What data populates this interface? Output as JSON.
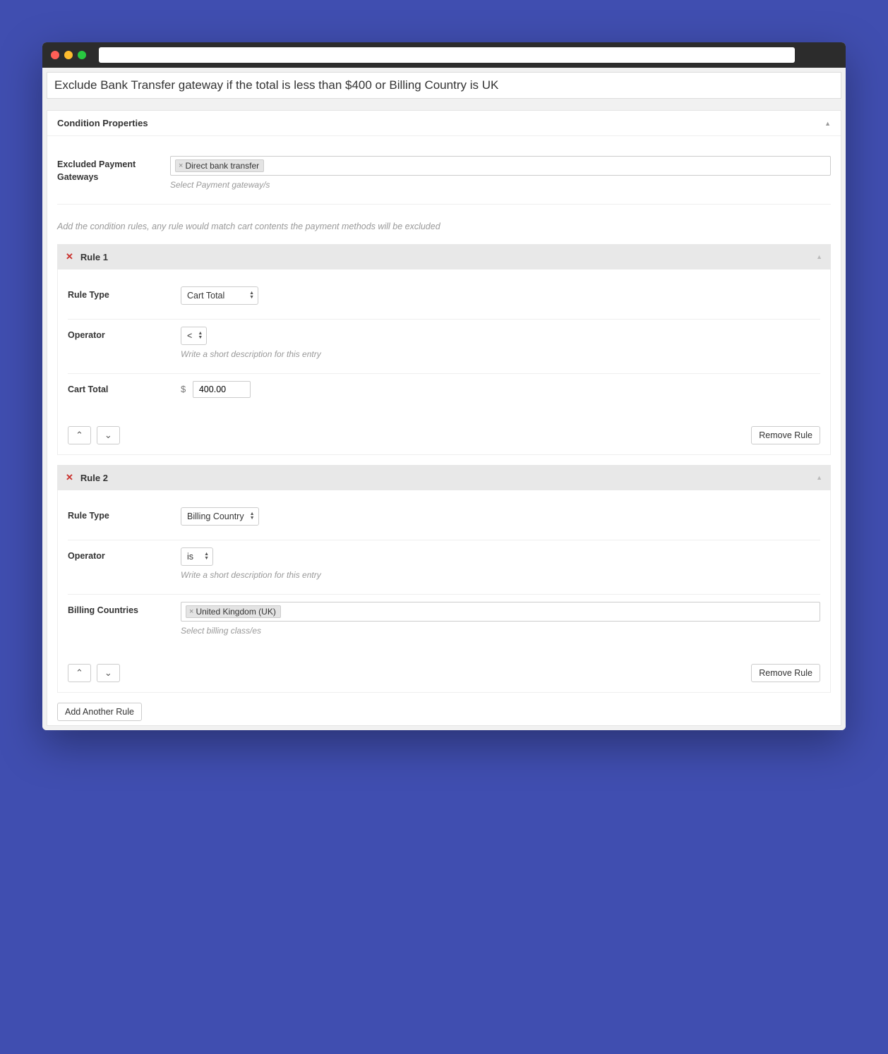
{
  "titleInput": "Exclude Bank Transfer gateway if the total is less than $400 or Billing Country is UK",
  "section": {
    "title": "Condition Properties"
  },
  "excludedGateways": {
    "label": "Excluded Payment Gateways",
    "tags": [
      "Direct bank transfer"
    ],
    "help": "Select Payment gateway/s"
  },
  "infoText": "Add the condition rules, any rule would match cart contents the payment methods will be excluded",
  "rules": [
    {
      "title": "Rule 1",
      "ruleTypeLabel": "Rule Type",
      "ruleTypeValue": "Cart Total",
      "operatorLabel": "Operator",
      "operatorValue": "<",
      "operatorHelp": "Write a short description for this entry",
      "valueLabel": "Cart Total",
      "currency": "$",
      "value": "400.00",
      "removeLabel": "Remove Rule"
    },
    {
      "title": "Rule 2",
      "ruleTypeLabel": "Rule Type",
      "ruleTypeValue": "Billing Country",
      "operatorLabel": "Operator",
      "operatorValue": "is",
      "operatorHelp": "Write a short description for this entry",
      "valueLabel": "Billing Countries",
      "tags": [
        "United Kingdom (UK)"
      ],
      "tagsHelp": "Select billing class/es",
      "removeLabel": "Remove Rule"
    }
  ],
  "addRuleLabel": "Add Another Rule"
}
